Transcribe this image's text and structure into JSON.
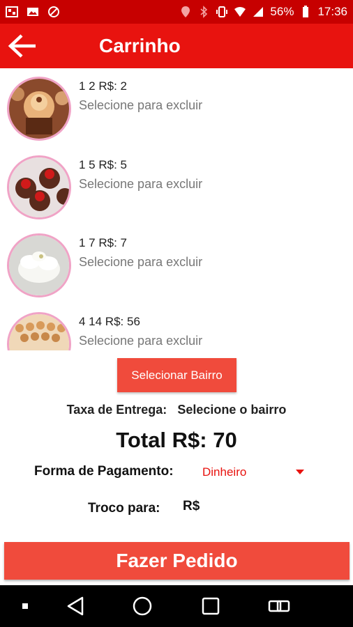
{
  "status_bar": {
    "battery": "56%",
    "time": "17:36",
    "icons_left": [
      "photo-icon",
      "image-icon",
      "blocked-icon"
    ],
    "icons_right": [
      "location-icon",
      "bluetooth-icon",
      "vibrate-icon",
      "wifi-icon",
      "signal-icon",
      "battery-icon"
    ]
  },
  "app_bar": {
    "title": "Carrinho",
    "color": "#e8130f"
  },
  "cart": {
    "items": [
      {
        "line1": "1 2 R$: 2",
        "line2": "Selecione para excluir",
        "image": "cupcake-photo"
      },
      {
        "line1": "1 5 R$: 5",
        "line2": "Selecione para excluir",
        "image": "cherry-cupcakes-photo"
      },
      {
        "line1": "1 7 R$: 7",
        "line2": "Selecione para excluir",
        "image": "cream-dessert-photo"
      },
      {
        "line1": "4 14 R$: 56",
        "line2": "Selecione para excluir",
        "image": "sweets-tray-photo"
      }
    ]
  },
  "bairro_button": {
    "label": "Selecionar Bairro"
  },
  "taxa": {
    "label": "Taxa de Entrega:",
    "value": "Selecione o bairro"
  },
  "total": {
    "text": "Total R$: 70"
  },
  "payment": {
    "label": "Forma de Pagamento:",
    "selected": "Dinheiro"
  },
  "troco": {
    "label": "Troco para:",
    "value": "R$"
  },
  "order_button": {
    "label": "Fazer Pedido"
  },
  "nav_bar": {
    "buttons": [
      "dot-icon",
      "back-triangle-icon",
      "home-circle-icon",
      "recents-square-icon",
      "switch-app-icon"
    ]
  }
}
